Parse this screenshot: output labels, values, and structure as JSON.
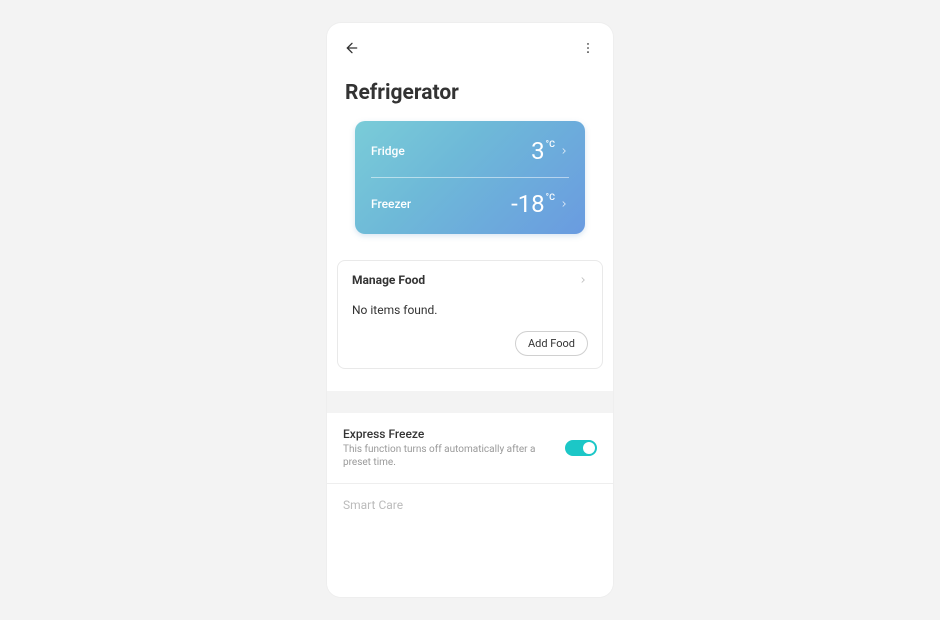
{
  "page": {
    "title": "Refrigerator"
  },
  "temperature": {
    "fridge": {
      "label": "Fridge",
      "value": "3",
      "unit": "°C"
    },
    "freezer": {
      "label": "Freezer",
      "value": "-18",
      "unit": "°C"
    }
  },
  "manage_food": {
    "title": "Manage Food",
    "empty_text": "No items found.",
    "add_button": "Add Food"
  },
  "settings": {
    "express_freeze": {
      "title": "Express Freeze",
      "desc": "This function turns off automatically after a preset time.",
      "enabled": true
    },
    "smart_care": {
      "title": "Smart Care"
    }
  }
}
